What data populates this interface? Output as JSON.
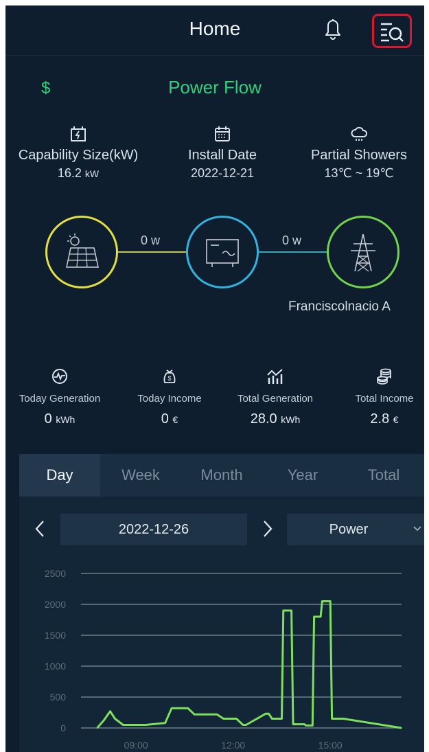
{
  "header": {
    "title": "Home"
  },
  "power_flow": {
    "currency_symbol": "$",
    "title": "Power Flow",
    "capability": {
      "label": "Capability Size(kW)",
      "value": "16.2",
      "unit": "kW"
    },
    "install_date": {
      "label": "Install Date",
      "value": "2022-12-21"
    },
    "weather": {
      "label": "Partial Showers",
      "value": "13℃ ~ 19℃"
    },
    "solar_to_inverter": "0 w",
    "inverter_to_grid": "0 w",
    "grid_name": "Franciscolnacio A"
  },
  "metrics": [
    {
      "label": "Today Generation",
      "value": "0",
      "unit": "kWh"
    },
    {
      "label": "Today Income",
      "value": "0",
      "unit": "€"
    },
    {
      "label": "Total Generation",
      "value": "28.0",
      "unit": "kWh"
    },
    {
      "label": "Total Income",
      "value": "2.8",
      "unit": "€"
    }
  ],
  "tabs": [
    "Day",
    "Week",
    "Month",
    "Year",
    "Total"
  ],
  "active_tab": "Day",
  "date_nav": {
    "date": "2022-12-26"
  },
  "metric_select": {
    "selected": "Power"
  },
  "colors": {
    "accent": "#2fd07c",
    "solar": "#e2e23a",
    "inverter": "#2fb4e0",
    "grid": "#6fd448",
    "series": "#7ee05a"
  },
  "chart_data": {
    "type": "line",
    "title": "",
    "xlabel": "",
    "ylabel": "",
    "ylim": [
      0,
      2500
    ],
    "yticks": [
      "0",
      "500",
      "1000",
      "1500",
      "2000",
      "2500"
    ],
    "xticks": [
      "09:00",
      "12:00",
      "15:00"
    ],
    "grid": true,
    "x_hours": [
      7.8,
      8.0,
      8.2,
      8.35,
      8.6,
      8.8,
      9.3,
      9.9,
      10.1,
      10.6,
      10.8,
      11.5,
      11.7,
      12.1,
      12.3,
      12.4,
      13.0,
      13.1,
      13.2,
      13.5,
      13.55,
      13.8,
      13.85,
      14.2,
      14.25,
      14.45,
      14.5,
      14.7,
      14.75,
      15.0,
      15.05,
      15.4,
      17.2
    ],
    "values": [
      0,
      120,
      270,
      150,
      50,
      50,
      50,
      80,
      320,
      320,
      220,
      220,
      150,
      150,
      50,
      50,
      230,
      230,
      150,
      150,
      1900,
      1900,
      60,
      60,
      40,
      40,
      1800,
      1800,
      2050,
      2050,
      150,
      150,
      0
    ]
  }
}
